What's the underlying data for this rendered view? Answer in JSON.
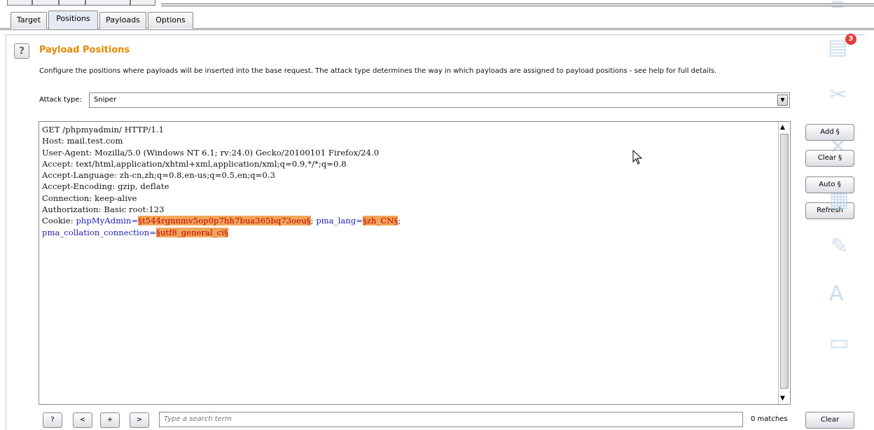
{
  "tabs": [
    {
      "label": "Target"
    },
    {
      "label": "Positions"
    },
    {
      "label": "Payloads"
    },
    {
      "label": "Options"
    }
  ],
  "panel": {
    "help_label": "?",
    "title": "Payload Positions",
    "description": "Configure the positions where payloads will be inserted into the base request. The attack type determines the way in which payloads are assigned to payload positions - see help for full details.",
    "attack_type_label": "Attack type:",
    "attack_type_value": "Sniper"
  },
  "request": {
    "lines": [
      "GET /phpmyadmin/ HTTP/1.1",
      "Host: mail.test.com",
      "User-Agent: Mozilla/5.0 (Windows NT 6.1; rv:24.0) Gecko/20100101 Firefox/24.0",
      "Accept: text/html,application/xhtml+xml,application/xml;q=0.9,*/*;q=0.8",
      "Accept-Language: zh-cn,zh;q=0.8,en-us;q=0.5,en;q=0.3",
      "Accept-Encoding: gzip, deflate",
      "Connection: keep-alive",
      "Authorization: Basic root:123"
    ],
    "cookie_prefix": "Cookie: ",
    "cookie_name1": "phpMyAdmin=",
    "cookie_val1": "§t544rgnnmv5op0p7hh7bua365bq73oeu§",
    "cookie_sep": "; ",
    "cookie_name2": "pma_lang=",
    "cookie_val2": "§zh_CN§",
    "cookie_end": ";",
    "cookie_name3": "pma_collation_connection=",
    "cookie_val3": "§utf8_general_ci§"
  },
  "side_buttons": {
    "add": "Add §",
    "clear": "Clear §",
    "auto": "Auto §",
    "refresh": "Refresh"
  },
  "bottom": {
    "help": "?",
    "prev": "<",
    "add": "+",
    "next": ">",
    "search_placeholder": "Type a search term",
    "matches": "0 matches",
    "clear": "Clear"
  },
  "overlay": {
    "badge": "3",
    "icons": [
      "menu-icon",
      "doc-icon",
      "tools-icon",
      "crop-icon",
      "table-icon",
      "pencil-icon",
      "text-icon",
      "card-icon"
    ]
  }
}
